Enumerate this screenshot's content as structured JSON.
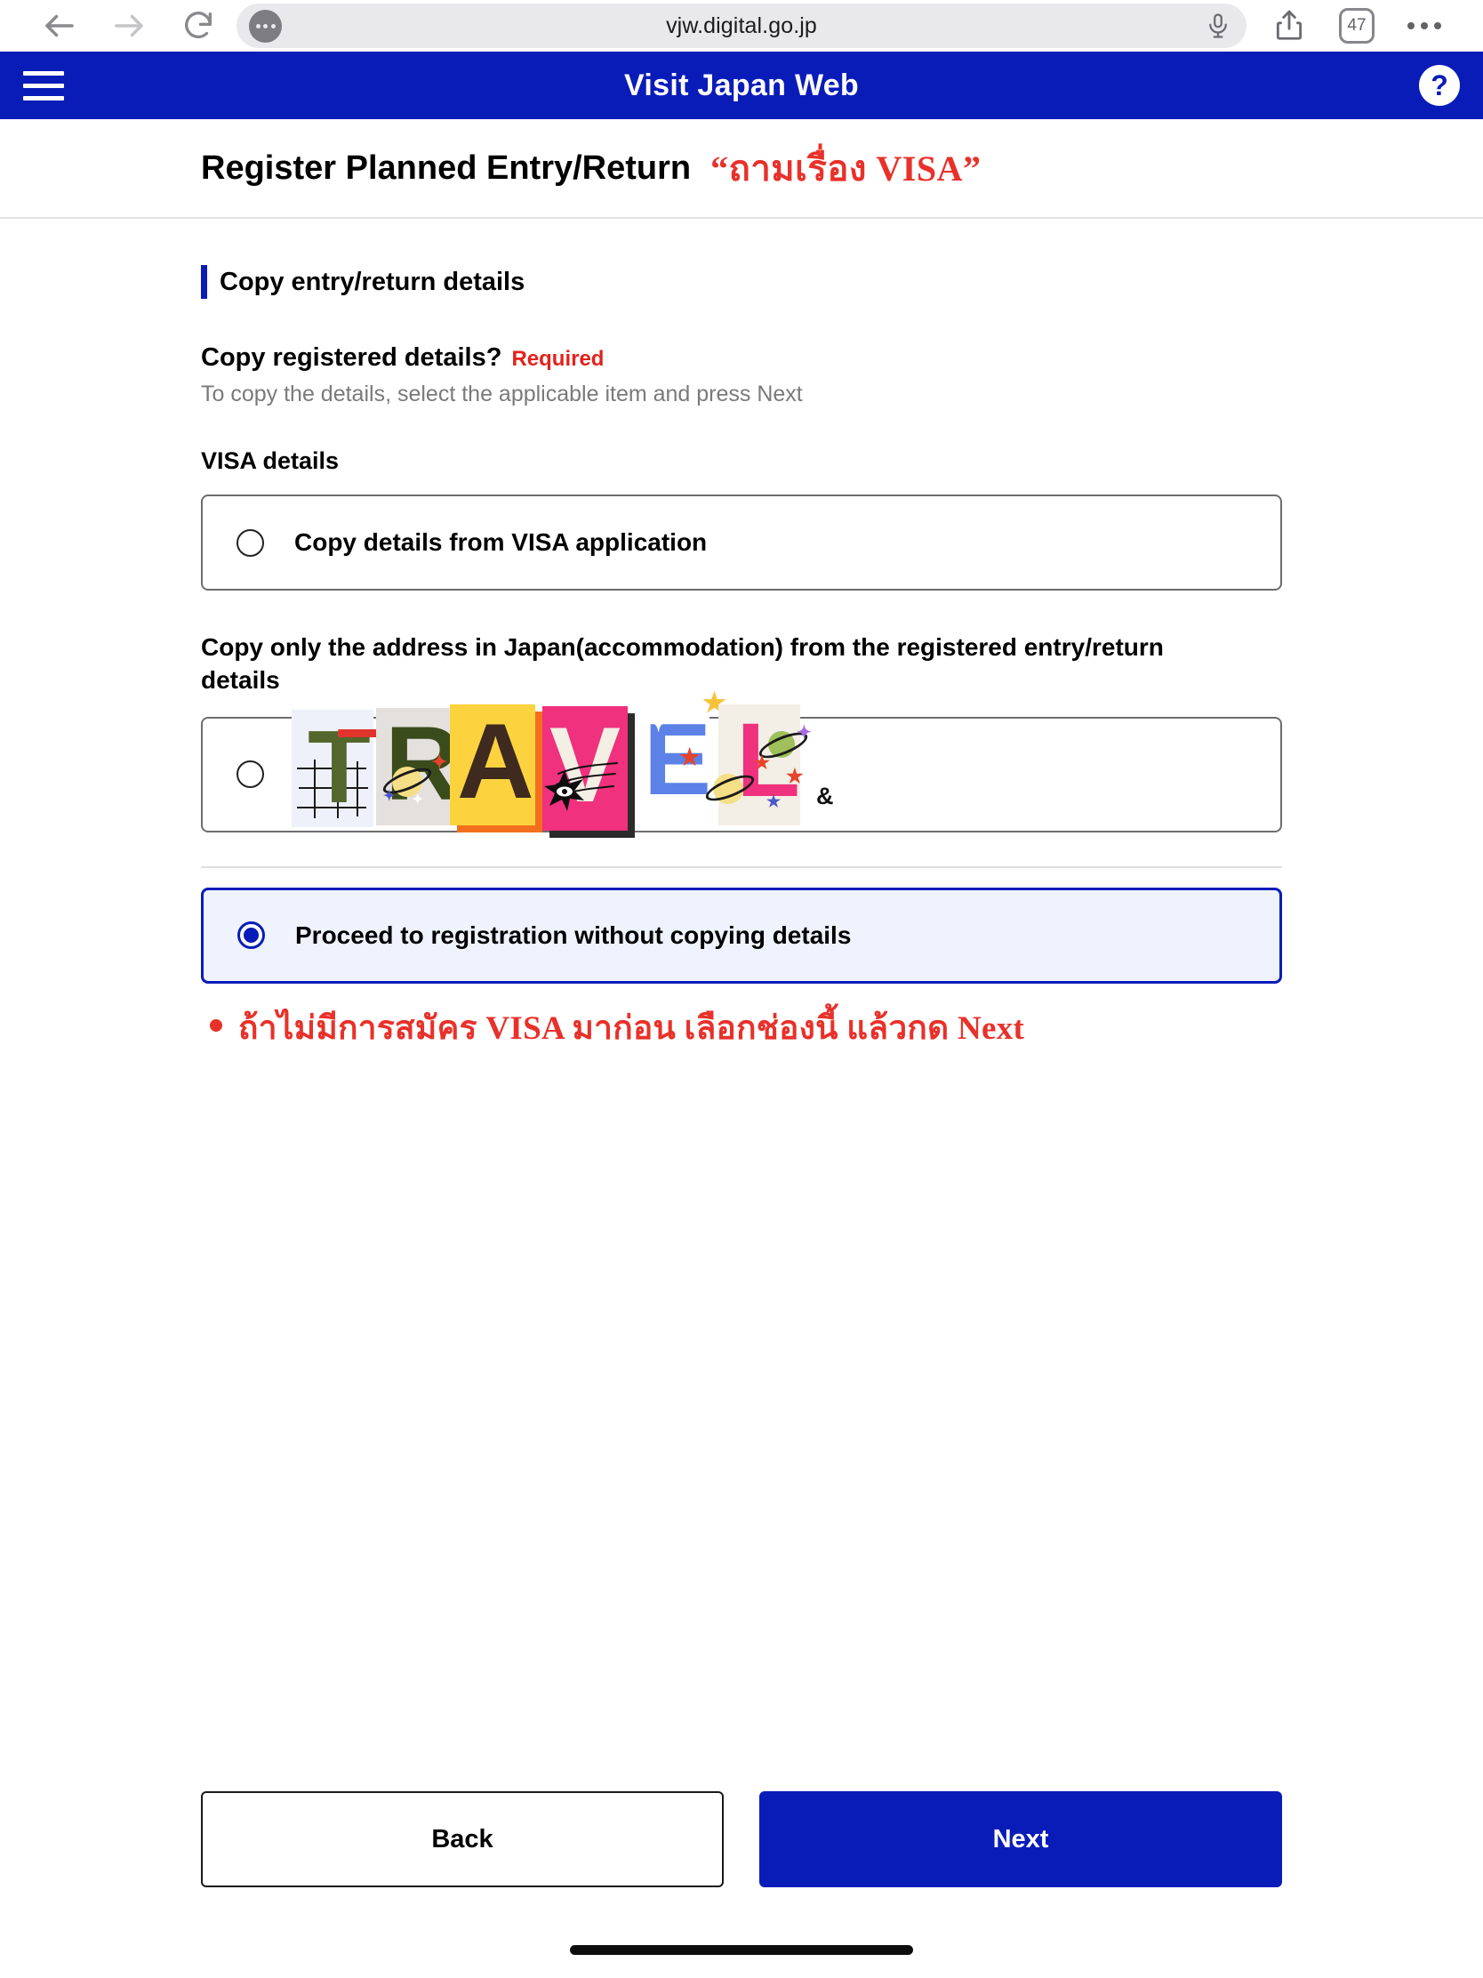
{
  "browser": {
    "url": "vjw.digital.go.jp",
    "tab_count": "47",
    "icons": {
      "back": "back-arrow-icon",
      "forward": "forward-arrow-icon",
      "reload": "reload-icon",
      "page_settings": "aa-page-settings-icon",
      "microphone": "microphone-icon",
      "share": "share-icon",
      "tabs": "tabs-icon",
      "more": "more-dots-icon"
    }
  },
  "app_header": {
    "title": "Visit Japan Web",
    "menu_icon": "hamburger-menu-icon",
    "help_icon": "help-question-icon",
    "bg_color": "#0a1cb8"
  },
  "page": {
    "title": "Register Planned Entry/Return",
    "annotation_title": "“ถามเรื่อง VISA”",
    "annotation_color": "#e8312a"
  },
  "section": {
    "heading": "Copy entry/return details",
    "question": "Copy registered details?",
    "required_badge": "Required",
    "help_text": "To copy the details, select the applicable item and press Next",
    "visa_label": "VISA details"
  },
  "options": [
    {
      "label": "Copy details from VISA application",
      "selected": false
    },
    {
      "label": "",
      "selected": false,
      "obscured_by_sticker": true
    },
    {
      "label": "Proceed to registration without copying details",
      "selected": true
    }
  ],
  "option2_heading": "Copy only the address in Japan(accommodation) from the registered entry/return details",
  "sticker": {
    "word": "TRAVEL",
    "letters": [
      "T",
      "R",
      "A",
      "V",
      "E",
      "L"
    ],
    "letter_colors": [
      "#53672d",
      "#3b4c1c",
      "#3e2a1e",
      "#f3efe4",
      "#5c82e8",
      "#f0317d"
    ],
    "tile_colors": [
      "#eef1f9",
      "#e3e0dd",
      "#fcd23f",
      "#f0317d",
      "#ffffff",
      "#f4efe6"
    ]
  },
  "annotation_note": {
    "text": "ถ้าไม่มีการสมัคร VISA มาก่อน เลือกช่องนี้ แล้วกด Next",
    "color": "#e8312a"
  },
  "footer": {
    "back_label": "Back",
    "next_label": "Next"
  }
}
